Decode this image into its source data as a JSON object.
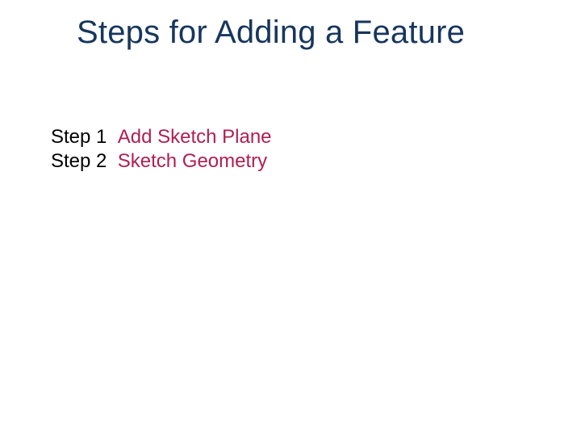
{
  "title": "Steps for Adding a Feature",
  "steps": [
    {
      "label": "Step 1",
      "desc": "Add Sketch Plane"
    },
    {
      "label": "Step 2",
      "desc": "Sketch Geometry"
    }
  ]
}
